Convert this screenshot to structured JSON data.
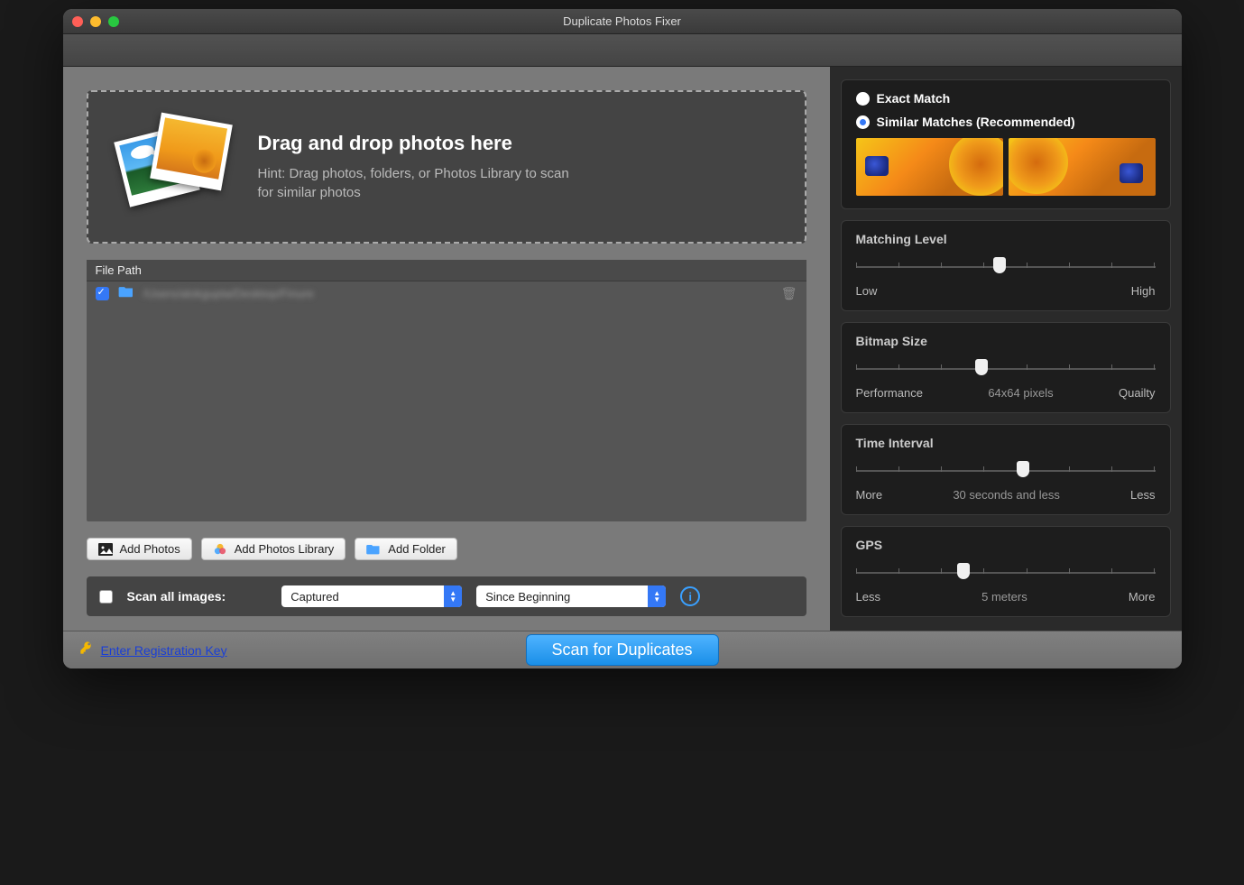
{
  "window": {
    "title": "Duplicate Photos Fixer"
  },
  "dropzone": {
    "heading": "Drag and drop photos here",
    "hint": "Hint: Drag photos, folders, or Photos Library to scan for similar photos"
  },
  "filelist": {
    "header": "File Path",
    "rows": [
      {
        "checked": true,
        "path": "/Users/alokgupta/Desktop/Finure"
      }
    ]
  },
  "buttons": {
    "add_photos": "Add Photos",
    "add_photos_library": "Add Photos Library",
    "add_folder": "Add Folder"
  },
  "scanrow": {
    "scan_all_label": "Scan all images:",
    "captured_select": "Captured",
    "since_select": "Since Beginning"
  },
  "sidebar": {
    "match": {
      "exact": "Exact Match",
      "similar": "Similar Matches (Recommended)"
    },
    "matching_level": {
      "title": "Matching Level",
      "low": "Low",
      "high": "High",
      "pos": 48
    },
    "bitmap": {
      "title": "Bitmap Size",
      "left": "Performance",
      "center": "64x64 pixels",
      "right": "Quailty",
      "pos": 42
    },
    "time": {
      "title": "Time Interval",
      "left": "More",
      "center": "30 seconds and less",
      "right": "Less",
      "pos": 56
    },
    "gps": {
      "title": "GPS",
      "left": "Less",
      "center": "5 meters",
      "right": "More",
      "pos": 36
    }
  },
  "footer": {
    "reg_link": "Enter Registration Key",
    "scan_btn": "Scan for Duplicates"
  }
}
